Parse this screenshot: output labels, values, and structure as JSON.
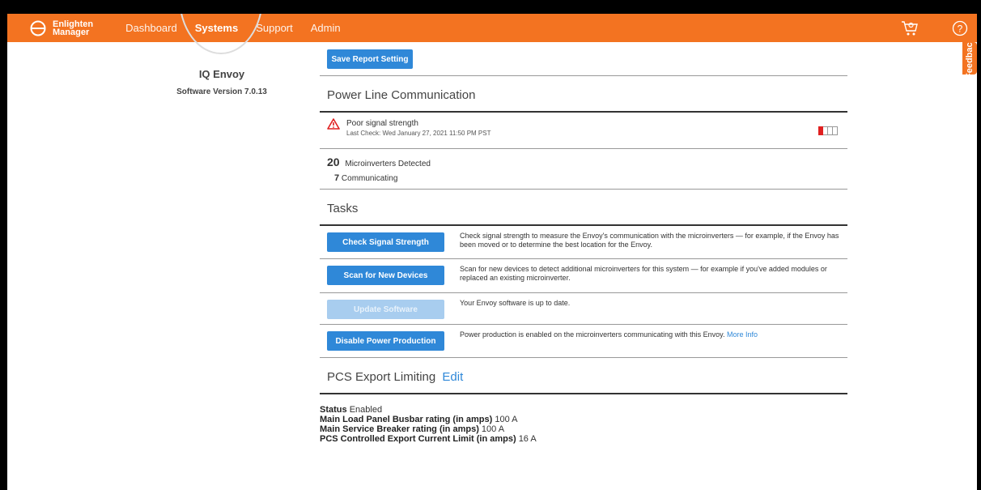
{
  "app": {
    "logo_line1": "Enlighten",
    "logo_line2": "Manager",
    "nav": [
      {
        "label": "Dashboard",
        "active": false
      },
      {
        "label": "Systems",
        "active": true
      },
      {
        "label": "Support",
        "active": false
      },
      {
        "label": "Admin",
        "active": false
      }
    ],
    "feedback_label": "Feedback",
    "brand_color": "#f37321",
    "icons": {
      "logo": "enlighten-logo-icon",
      "cart": "cart-icon",
      "help": "help-icon"
    }
  },
  "device": {
    "name": "IQ Envoy",
    "software_version": "Software Version 7.0.13"
  },
  "report": {
    "save_label": "Save Report Setting"
  },
  "plc": {
    "title": "Power Line Communication",
    "status": "Poor signal strength",
    "last_check": "Last Check: Wed January 27, 2021 11:50 PM PST",
    "signal_level_bars": 1,
    "signal_total_bars": 4,
    "detected_count": "20",
    "detected_label": "Microinverters Detected",
    "communicating_count": "7",
    "communicating_label": "Communicating"
  },
  "tasks": {
    "title": "Tasks",
    "items": [
      {
        "label": "Check Signal Strength",
        "disabled": false,
        "desc": "Check signal strength to measure the Envoy's communication with the microinverters — for example, if the Envoy has been moved or to determine the best location for the Envoy."
      },
      {
        "label": "Scan for New Devices",
        "disabled": false,
        "desc": "Scan for new devices to detect additional microinverters for this system — for example if you've added modules or replaced an existing microinverter."
      },
      {
        "label": "Update Software",
        "disabled": true,
        "desc": "Your Envoy software is up to date."
      },
      {
        "label": "Disable Power Production",
        "disabled": false,
        "desc": "Power production is enabled on the microinverters communicating with this Envoy.",
        "more": "More Info"
      }
    ]
  },
  "pcs": {
    "title": "PCS Export Limiting",
    "edit_label": "Edit",
    "status_label": "Status",
    "status_value": "Enabled",
    "busbar_label": "Main Load Panel Busbar rating (in amps)",
    "busbar_value": "100 A",
    "breaker_label": "Main Service Breaker rating (in amps)",
    "breaker_value": "100 A",
    "limit_label": "PCS Controlled Export Current Limit (in amps)",
    "limit_value": "16 A"
  }
}
